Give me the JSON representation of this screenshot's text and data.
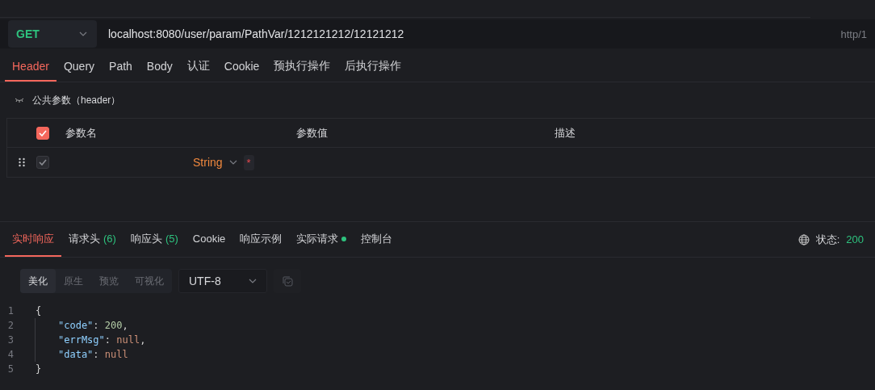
{
  "request": {
    "method": "GET",
    "url": "localhost:8080/user/param/PathVar/1212121212/12121212",
    "protocol": "http/1"
  },
  "request_tabs": [
    {
      "label": "Header",
      "selected": true
    },
    {
      "label": "Query",
      "selected": false
    },
    {
      "label": "Path",
      "selected": false
    },
    {
      "label": "Body",
      "selected": false
    },
    {
      "label": "认证",
      "selected": false
    },
    {
      "label": "Cookie",
      "selected": false
    },
    {
      "label": "预执行操作",
      "selected": false
    },
    {
      "label": "后执行操作",
      "selected": false
    }
  ],
  "common_params": {
    "title": "公共参数（header）",
    "expanded": false
  },
  "param_table": {
    "all_checked": true,
    "columns": [
      "参数名",
      "参数值",
      "描述"
    ],
    "rows": [
      {
        "checked": true,
        "type": "String",
        "required_mark": "*"
      }
    ]
  },
  "response_tabs": [
    {
      "label": "实时响应",
      "selected": true
    },
    {
      "label": "请求头",
      "count": "(6)",
      "selected": false
    },
    {
      "label": "响应头",
      "count": "(5)",
      "selected": false
    },
    {
      "label": "Cookie",
      "selected": false
    },
    {
      "label": "响应示例",
      "selected": false
    },
    {
      "label": "实际请求",
      "dot": true,
      "selected": false
    },
    {
      "label": "控制台",
      "selected": false
    }
  ],
  "status": {
    "label": "状态:",
    "value": "200"
  },
  "view_modes": [
    {
      "label": "美化",
      "selected": true
    },
    {
      "label": "原生",
      "selected": false
    },
    {
      "label": "预览",
      "selected": false
    },
    {
      "label": "可视化",
      "selected": false
    }
  ],
  "encoding": "UTF-8",
  "code_lines": [
    {
      "number": "1",
      "tokens": [
        {
          "kind": "punct",
          "text": "{"
        }
      ],
      "children": [
        {
          "number": "2",
          "tokens": [
            {
              "kind": "key",
              "text": "\"code\""
            },
            {
              "kind": "punct",
              "text": ": "
            },
            {
              "kind": "number",
              "text": "200"
            },
            {
              "kind": "punct",
              "text": ","
            }
          ]
        },
        {
          "number": "3",
          "tokens": [
            {
              "kind": "key",
              "text": "\"errMsg\""
            },
            {
              "kind": "punct",
              "text": ": "
            },
            {
              "kind": "null",
              "text": "null"
            },
            {
              "kind": "punct",
              "text": ","
            }
          ]
        },
        {
          "number": "4",
          "tokens": [
            {
              "kind": "key",
              "text": "\"data\""
            },
            {
              "kind": "punct",
              "text": ": "
            },
            {
              "kind": "null",
              "text": "null"
            }
          ]
        }
      ]
    },
    {
      "number": "5",
      "tokens": [
        {
          "kind": "punct",
          "text": "}"
        }
      ]
    }
  ]
}
